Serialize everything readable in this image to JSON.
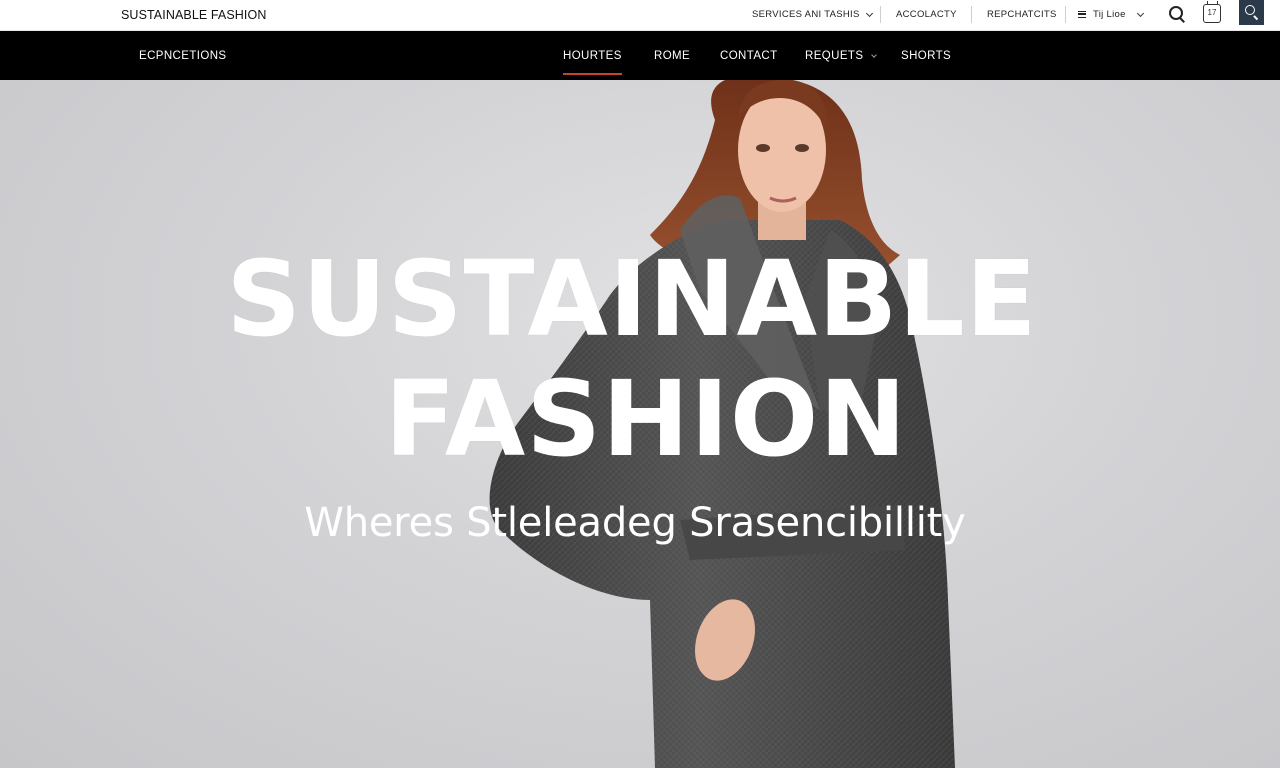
{
  "utility_bar": {
    "brand": "SUSTAINABLE FASHION",
    "links": [
      "SERVICES ANI TASHIS",
      "ACCOLACTY",
      "REPCHATCITS"
    ],
    "language_label": "Tij Lioe",
    "calendar_day": "17",
    "icons": [
      "search-icon",
      "calendar-icon",
      "search-button-icon",
      "menu-icon",
      "chevron-down-icon"
    ]
  },
  "main_nav": {
    "left_label": "ECPNCETIONS",
    "items": [
      "HOURTES",
      "ROME",
      "CONTACT",
      "REQUETS",
      "SHORTS"
    ],
    "active_item": "HOURTES"
  },
  "hero": {
    "title_line1": "SUSTAINABLE",
    "title_line2": "FASHION",
    "subtitle": "Wheres Stleleadeg Srasencibillity"
  },
  "colors": {
    "nav_background": "#000000",
    "active_underline": "#c9442b",
    "search_button": "#2b3a4a",
    "hero_background": "#d3d3d6",
    "coat": "#4a4a4a",
    "hair": "#7a3a20"
  }
}
